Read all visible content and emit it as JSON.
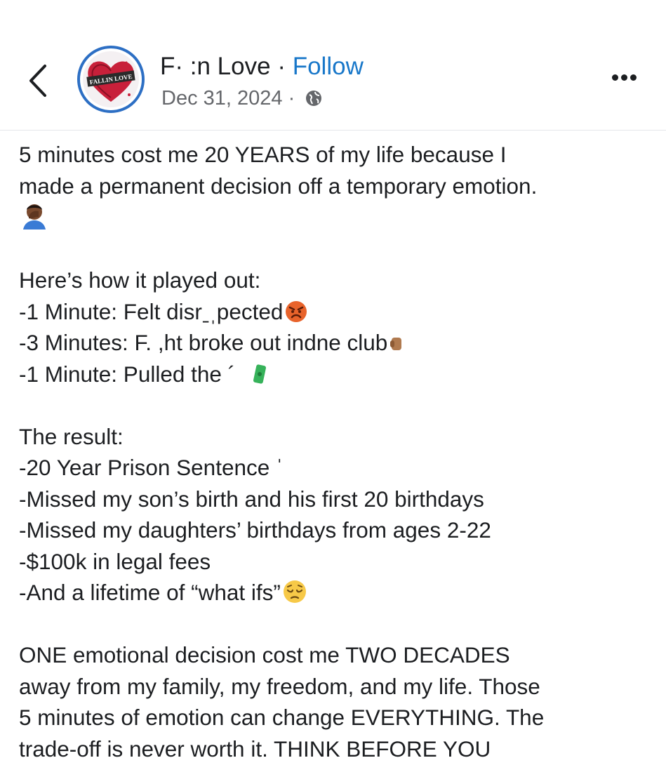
{
  "header": {
    "page_name": "F· :n Love",
    "separator": "·",
    "follow_label": "Follow",
    "date": "Dec 31, 2024",
    "date_separator": "·",
    "avatar_logo_text": "FALLIN LOVE",
    "icons": {
      "back": "chevron-left-icon",
      "privacy": "globe-icon",
      "more": "more-options-icon"
    }
  },
  "post": {
    "lines": [
      "5 minutes cost me 20 YEARS of my life because I",
      "made a permanent decision off a temporary emotion.",
      "Here’s how it played out:",
      "-1 Minute: Felt disrˍˌpected",
      "-3 Minutes: F. ,ht broke out indne club",
      "-1 Minute: Pulled the ´",
      "The result:",
      "-20 Year Prison Sentence ˈ",
      "-Missed my son’s birth and his first 20 birthdays",
      "-Missed my daughters’ birthdays from ages 2-22",
      "-$100k in legal fees",
      "-And a lifetime of “what ifs”",
      "ONE emotional decision cost me TWO DECADES",
      "away from my family, my freedom, and my life. Those",
      "5 minutes of emotion can change EVERYTHING. The",
      "trade-off is never worth it. THINK BEFORE YOU"
    ],
    "emojis": {
      "facepalm": "man-facepalming-emoji",
      "angry": "angry-face-emoji",
      "fist": "fist-emoji",
      "money": "money-emoji",
      "pensive": "pensive-face-emoji"
    }
  },
  "colors": {
    "follow": "#1877c9",
    "text": "#1c1e21",
    "secondary_text": "#65676b",
    "avatar_ring": "#2d6fc4",
    "divider": "#e4e6eb"
  }
}
